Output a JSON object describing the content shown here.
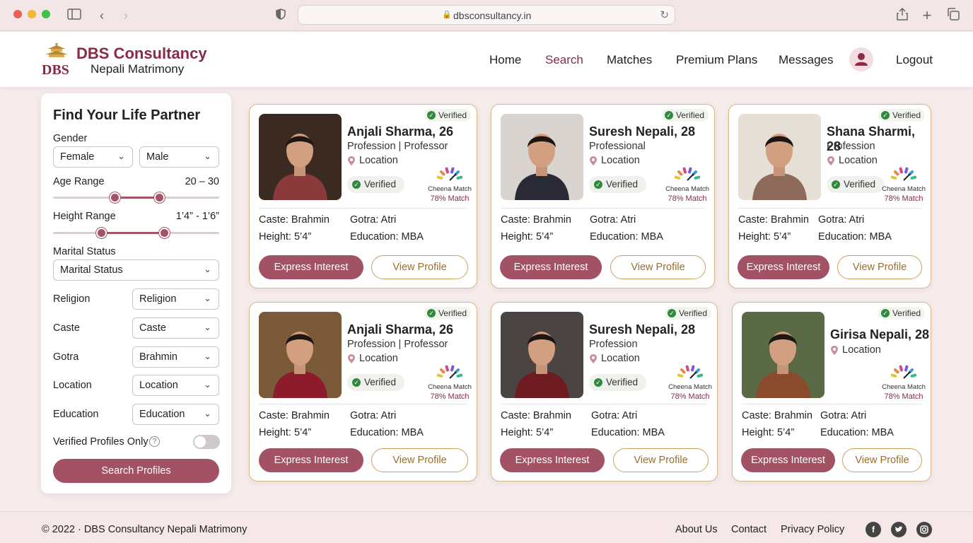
{
  "browser": {
    "url": "dbsconsultancy.in"
  },
  "header": {
    "brand": "DBS Consultancy",
    "tagline": "Nepali Matrimony",
    "logo_text": "DBS",
    "nav": [
      {
        "label": "Home",
        "active": false
      },
      {
        "label": "Search",
        "active": true
      },
      {
        "label": "Matches",
        "active": false
      },
      {
        "label": "Premium Plans",
        "active": false
      },
      {
        "label": "Messages",
        "active": false
      }
    ],
    "logout_label": "Logout",
    "accent_color": "#8b2a44"
  },
  "sidebar": {
    "title": "Find Your Life Partner",
    "gender_label": "Gender",
    "gender_from": "Female",
    "gender_to": "Male",
    "age_label": "Age Range",
    "age_value": "20 – 30",
    "age_range_fraction": [
      0.37,
      0.64
    ],
    "height_label": "Height Range",
    "height_value": "1’4” - 1’6”",
    "height_range_fraction": [
      0.29,
      0.67
    ],
    "marital_label": "Marital Status",
    "marital_value": "Marital Status",
    "religion_label": "Religion",
    "religion_value": "Religion",
    "caste_label": "Caste",
    "caste_value": "Caste",
    "gotra_label": "Gotra",
    "gotra_value": "Brahmin",
    "location_label": "Location",
    "location_value": "Location",
    "education_label": "Education",
    "education_value": "Education",
    "verified_only_label": "Verified Profiles Only",
    "verified_only_on": false,
    "search_button": "Search Profiles"
  },
  "cards": [
    {
      "name": "Anjali Sharma, 26",
      "line1": "Profession | Professor",
      "location": "Location",
      "badge": "Verified",
      "verified_pill": "Verified",
      "match_label": "Cheena Match",
      "match_pct": "78% Match",
      "caste": "Caste: Brahmin",
      "gotra": "Gotra: Atri",
      "height": "Height: 5’4”",
      "education": "Education: MBA",
      "interest": "Express Interest",
      "view": "View Profile"
    },
    {
      "name": "Suresh Nepali, 28",
      "line1": "Professional",
      "location": "Location",
      "badge": "Verified",
      "verified_pill": "Verified",
      "match_label": "Cheena Match",
      "match_pct": "78% Match",
      "caste": "Caste: Brahmin",
      "gotra": "Gotra: Atri",
      "height": "Height: 5’4”",
      "education": "Education: MBA",
      "interest": "Express Interest",
      "view": "View Profile"
    },
    {
      "name": "Shana Sharmi, 28",
      "line1": "Profession",
      "location": "Location",
      "badge": "Verified",
      "verified_pill": "Verified",
      "match_label": "Cheena Match",
      "match_pct": "78% Match",
      "caste": "Caste: Brahmin",
      "gotra": "Gotra: Atri",
      "height": "Height: 5’4”",
      "education": "Education: MBA",
      "interest": "Express Interest",
      "view": "View Profile"
    },
    {
      "name": "Anjali Sharma, 26",
      "line1": "Profession | Professor",
      "location": "Location",
      "badge": "Verified",
      "verified_pill": "Verified",
      "match_label": "Cheena Match",
      "match_pct": "78% Match",
      "caste": "Caste: Brahmin",
      "gotra": "Gotra: Atri",
      "height": "Height: 5’4”",
      "education": "Education: MBA",
      "interest": "Express Interest",
      "view": "View Profile"
    },
    {
      "name": "Suresh Nepali, 28",
      "line1": "Profession",
      "location": "Location",
      "badge": "Verified",
      "verified_pill": "Verified",
      "match_label": "Cheena Match",
      "match_pct": "78% Match",
      "caste": "Caste: Brahmin",
      "gotra": "Gotra: Atri",
      "height": "Height: 5’4”",
      "education": "Education: MBA",
      "interest": "Express Interest",
      "view": "View Profile"
    },
    {
      "name": "Girisa Nepali, 28",
      "line1": "",
      "location": "Location",
      "badge": "Verified",
      "verified_pill": "",
      "match_label": "Cheena Match",
      "match_pct": "78% Match",
      "caste": "Caste: Brahmin",
      "gotra": "Gotra: Atri",
      "height": "Height: 5’4”",
      "education": "Education: MBA",
      "interest": "Express Interest",
      "view": "View Profile"
    }
  ],
  "footer": {
    "copyright": "© 2022 · DBS Consultancy  Nepali Matrimony",
    "links": [
      "About Us",
      "Contact",
      "Privacy Policy"
    ],
    "social_icons": [
      "facebook-icon",
      "twitter-icon",
      "instagram-icon"
    ]
  }
}
